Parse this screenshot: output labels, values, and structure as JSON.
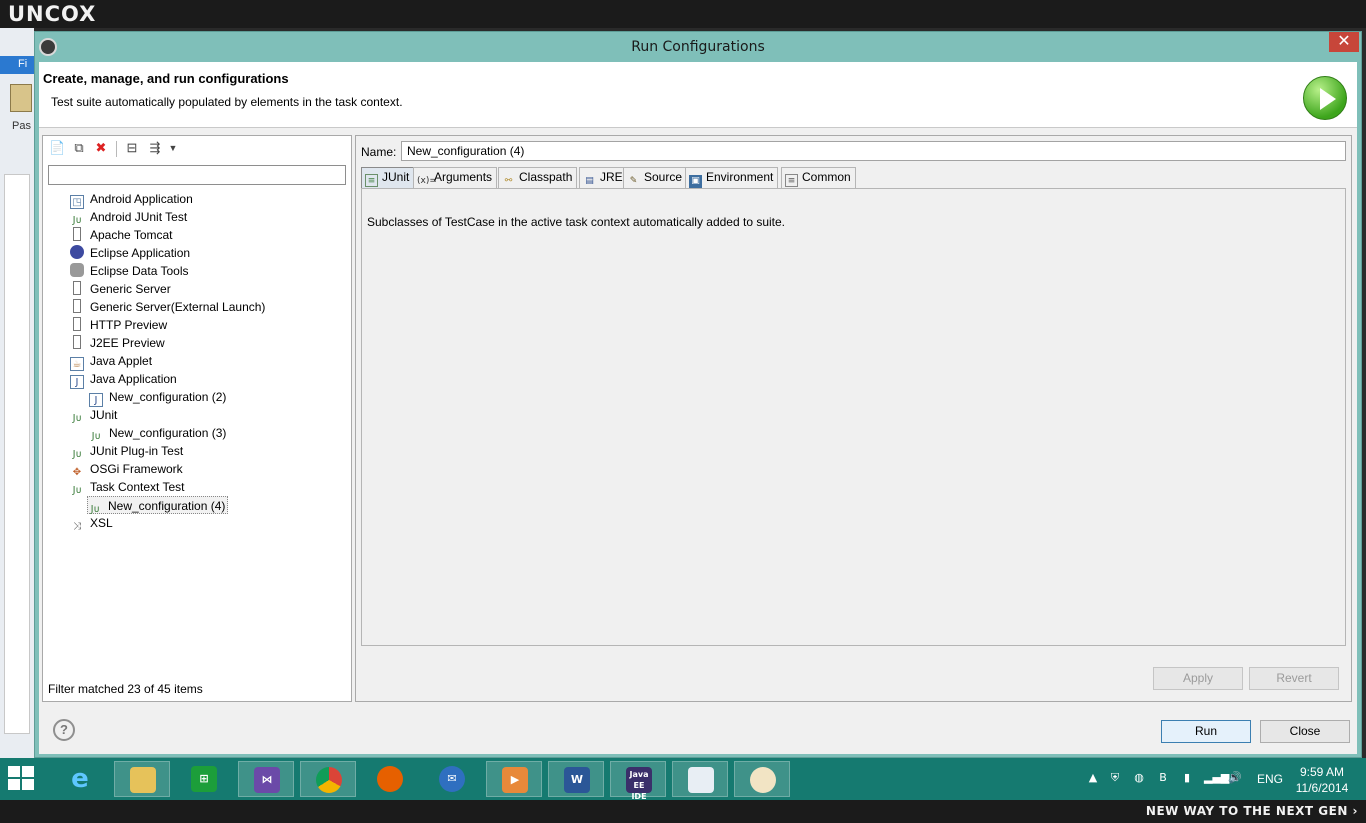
{
  "overlay": {
    "brand": "UNCOX",
    "slogan": "NEW WAY TO THE NEXT GEN ›"
  },
  "background_app": {
    "ribbon_label": "Fi",
    "paste_label": "Pas"
  },
  "dialog": {
    "title": "Run Configurations",
    "header_title": "Create, manage, and run configurations",
    "header_subtitle": "Test suite automatically populated by elements in the task context."
  },
  "left_panel": {
    "filter_value": "",
    "status": "Filter matched 23 of 45 items",
    "toolbar_icons": [
      "new-config-icon",
      "duplicate-icon",
      "delete-icon",
      "collapse-all-icon",
      "filter-icon",
      "dropdown-icon"
    ],
    "tree": [
      {
        "label": "Android Application",
        "icon": "android-app-icon",
        "level": 0
      },
      {
        "label": "Android JUnit Test",
        "icon": "junit-icon",
        "level": 0
      },
      {
        "label": "Apache Tomcat",
        "icon": "server-icon",
        "level": 0
      },
      {
        "label": "Eclipse Application",
        "icon": "eclipse-icon",
        "level": 0
      },
      {
        "label": "Eclipse Data Tools",
        "icon": "database-icon",
        "level": 0
      },
      {
        "label": "Generic Server",
        "icon": "server-icon",
        "level": 0
      },
      {
        "label": "Generic Server(External Launch)",
        "icon": "server-icon",
        "level": 0
      },
      {
        "label": "HTTP Preview",
        "icon": "server-icon",
        "level": 0
      },
      {
        "label": "J2EE Preview",
        "icon": "server-icon",
        "level": 0
      },
      {
        "label": "Java Applet",
        "icon": "applet-icon",
        "level": 0
      },
      {
        "label": "Java Application",
        "icon": "java-app-icon",
        "level": 0
      },
      {
        "label": "New_configuration (2)",
        "icon": "java-app-icon",
        "level": 1
      },
      {
        "label": "JUnit",
        "icon": "junit-icon",
        "level": 0
      },
      {
        "label": "New_configuration (3)",
        "icon": "junit-icon",
        "level": 1
      },
      {
        "label": "JUnit Plug-in Test",
        "icon": "junit-plugin-icon",
        "level": 0
      },
      {
        "label": "OSGi Framework",
        "icon": "osgi-icon",
        "level": 0
      },
      {
        "label": "Task Context Test",
        "icon": "task-context-icon",
        "level": 0
      },
      {
        "label": "New_configuration (4)",
        "icon": "task-context-icon",
        "level": 1,
        "selected": true
      },
      {
        "label": "XSL",
        "icon": "xsl-icon",
        "level": 0
      }
    ]
  },
  "right_panel": {
    "name_label": "Name:",
    "name_value": "New_configuration (4)",
    "tabs": [
      {
        "label": "JUnit",
        "icon": "junit-tab-icon",
        "active": true
      },
      {
        "label": "Arguments",
        "icon": "arguments-icon",
        "active": false
      },
      {
        "label": "Classpath",
        "icon": "classpath-icon",
        "active": false
      },
      {
        "label": "JRE",
        "icon": "jre-icon",
        "active": false
      },
      {
        "label": "Source",
        "icon": "source-icon",
        "active": false
      },
      {
        "label": "Environment",
        "icon": "environment-icon",
        "active": false
      },
      {
        "label": "Common",
        "icon": "common-icon",
        "active": false
      }
    ],
    "tab_content": "Subclasses of TestCase in the active task context automatically added to suite.",
    "apply_label": "Apply",
    "revert_label": "Revert"
  },
  "footer": {
    "help_label": "?",
    "run_label": "Run",
    "close_label": "Close"
  },
  "taskbar": {
    "apps": [
      "internet-explorer-icon",
      "file-explorer-icon",
      "store-icon",
      "visual-studio-icon",
      "chrome-icon",
      "firefox-icon",
      "thunderbird-icon",
      "media-player-icon",
      "word-icon",
      "eclipse-jee-icon",
      "notepad-icon",
      "paint-icon"
    ],
    "eclipse_label": "Java EE IDE",
    "word_label": "W",
    "language": "ENG",
    "time": "9:59 AM",
    "date": "11/6/2014"
  },
  "colors": {
    "dialog_frame": "#7fbfb9",
    "taskbar": "#157a70",
    "close_button": "#c7463a",
    "run_icon": "#3da51c"
  }
}
